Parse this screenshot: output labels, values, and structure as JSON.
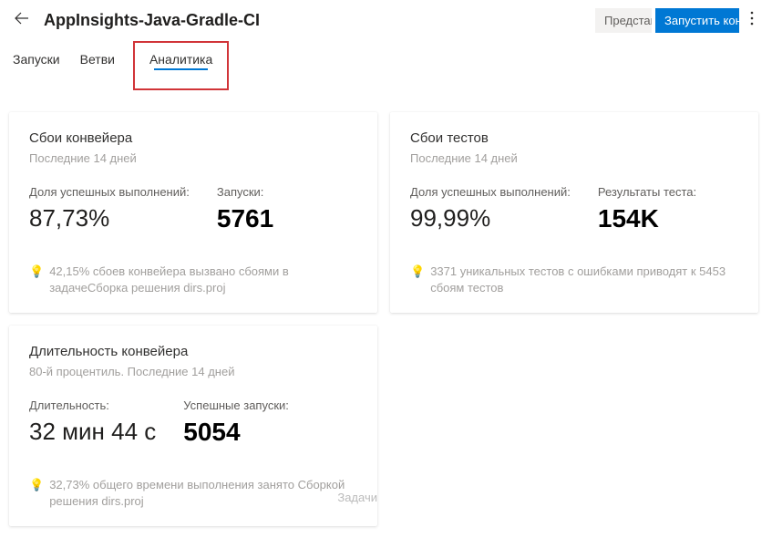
{
  "header": {
    "title": "AppInsights-Java-Gradle-CI",
    "view_btn": "Представление",
    "run_btn": "Запустить конвейер"
  },
  "tabs": {
    "runs": "Запуски",
    "branches": "Ветви",
    "analytics": "Аналитика"
  },
  "cards": {
    "pipeline_failures": {
      "title": "Сбои конвейера",
      "sub": "Последние 14 дней",
      "m1_label": "Доля успешных выполнений:",
      "m1_value": "87,73%",
      "m2_label": "Запуски:",
      "m2_value": "5761",
      "insight": "42,15% сбоев конвейера вызвано сбоями в задачеСборка решения dirs.proj"
    },
    "test_failures": {
      "title": "Сбои тестов",
      "sub": "Последние 14 дней",
      "m1_label": "Доля успешных выполнений:",
      "m1_value": "99,99%",
      "m2_label": "Результаты теста:",
      "m2_value": "154K",
      "insight": "3371 уникальных тестов с ошибками приводят к 5453 сбоям тестов"
    },
    "pipeline_duration": {
      "title": "Длительность конвейера",
      "sub": "80-й процентиль. Последние 14 дней",
      "m1_label": "Длительность:",
      "m1_value": "32 мин 44 с",
      "m2_label": "Успешные запуски:",
      "m2_value": "5054",
      "insight": "32,73% общего времени выполнения занято Сборкой решения dirs.proj",
      "side_label": "Задачи"
    }
  }
}
